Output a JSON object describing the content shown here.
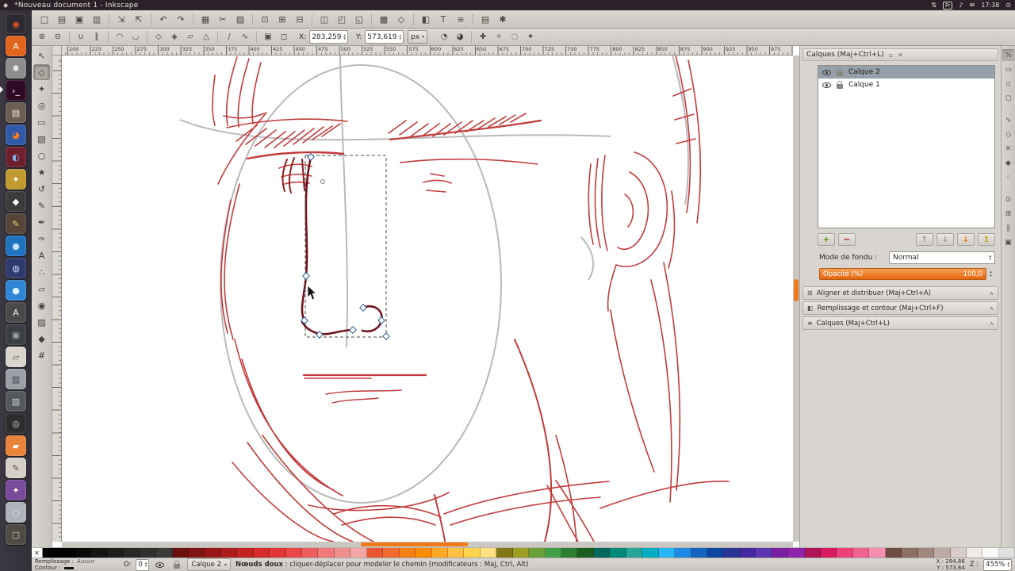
{
  "ui": {
    "spin_up": "▴",
    "spin_down": "▾",
    "caret_down": "▾",
    "collapse_glyph": "∧",
    "close_glyph": "✕",
    "float_glyph": "▫"
  },
  "desktop": {
    "title": "*Nouveau document 1 - Inkscape",
    "app_icon_glyph": "◆",
    "indicators": [
      {
        "name": "indicator-network",
        "glyph": "⇅"
      },
      {
        "name": "indicator-keyboard",
        "glyph": "Fr",
        "badge": true
      },
      {
        "name": "indicator-sound",
        "glyph": "♪"
      },
      {
        "name": "indicator-messages",
        "glyph": "✉"
      },
      {
        "name": "clock",
        "glyph": "17:38"
      },
      {
        "name": "indicator-session",
        "glyph": "⊙"
      }
    ]
  },
  "launcher": {
    "items": [
      {
        "name": "dash-home",
        "glyph": "◉",
        "bg": "#2d2a33",
        "fg": "#e95420"
      },
      {
        "name": "software-center",
        "glyph": "A",
        "bg": "#e0641c",
        "fg": "#ffffff"
      },
      {
        "name": "system-settings",
        "glyph": "✱",
        "bg": "#8d8d8d",
        "fg": "#f2f2f2"
      },
      {
        "name": "terminal",
        "glyph": "›_",
        "bg": "#300a24",
        "fg": "#ffffff",
        "active": true
      },
      {
        "name": "files",
        "glyph": "▤",
        "bg": "#6b5f54",
        "fg": "#f0e8dc"
      },
      {
        "name": "firefox",
        "glyph": "◕",
        "bg": "#2e5aa8",
        "fg": "#ff7a1a"
      },
      {
        "name": "media-player",
        "glyph": "◐",
        "bg": "#6e1f2e",
        "fg": "#7fb2e5"
      },
      {
        "name": "image-editor",
        "glyph": "✦",
        "bg": "#c09a2f",
        "fg": "#ffffff"
      },
      {
        "name": "inkscape",
        "glyph": "◆",
        "bg": "#3b3b3b",
        "fg": "#ffffff"
      },
      {
        "name": "pen-app",
        "glyph": "✎",
        "bg": "#57453a",
        "fg": "#f5d76e"
      },
      {
        "name": "color-app",
        "glyph": "●",
        "bg": "#1f74c0",
        "fg": "#bfe1ff"
      },
      {
        "name": "ink-app",
        "glyph": "◍",
        "bg": "#2e3a6e",
        "fg": "#cfd8ff"
      },
      {
        "name": "sphere-app",
        "glyph": "●",
        "bg": "#2f86d6",
        "fg": "#dff0ff"
      },
      {
        "name": "font-viewer",
        "glyph": "A",
        "bg": "#4a4a4a",
        "fg": "#eeeeee"
      },
      {
        "name": "utility-app",
        "glyph": "▣",
        "bg": "#3a3f44",
        "fg": "#9aa4ad"
      },
      {
        "name": "eraser-app",
        "glyph": "▱",
        "bg": "#d9d4cc",
        "fg": "#6b6257"
      },
      {
        "name": "gradient-app",
        "glyph": "▨",
        "bg": "#9aa0a6",
        "fg": "#434a51"
      },
      {
        "name": "system-monitor",
        "glyph": "▥",
        "bg": "#55595e",
        "fg": "#cfd3d8"
      },
      {
        "name": "camera-app",
        "glyph": "◎",
        "bg": "#2c2c2c",
        "fg": "#cfd3d8"
      },
      {
        "name": "folder-app",
        "glyph": "▰",
        "bg": "#e8833a",
        "fg": "#ffffff"
      },
      {
        "name": "notes-app",
        "glyph": "✎",
        "bg": "#d6d0c6",
        "fg": "#5a5248"
      },
      {
        "name": "screenshot-app",
        "glyph": "✦",
        "bg": "#7a4a9c",
        "fg": "#fff8dd"
      },
      {
        "name": "disc-burner",
        "glyph": "◌",
        "bg": "#aeb4ba",
        "fg": "#ffffff"
      },
      {
        "name": "archive-app",
        "glyph": "▢",
        "bg": "#4f4a44",
        "fg": "#d8d2c8"
      }
    ]
  },
  "commandbar": {
    "buttons": [
      {
        "name": "new-document",
        "glyph": "□"
      },
      {
        "name": "open-document",
        "glyph": "▤"
      },
      {
        "name": "save-document",
        "glyph": "▣"
      },
      {
        "name": "print-document",
        "glyph": "▥"
      },
      {
        "sep": true
      },
      {
        "name": "import",
        "glyph": "⇲"
      },
      {
        "name": "export",
        "glyph": "⇱"
      },
      {
        "sep": true
      },
      {
        "name": "undo",
        "glyph": "↶"
      },
      {
        "name": "redo",
        "glyph": "↷"
      },
      {
        "sep": true
      },
      {
        "name": "copy",
        "glyph": "▦"
      },
      {
        "name": "cut",
        "glyph": "✂"
      },
      {
        "name": "paste",
        "glyph": "▨"
      },
      {
        "sep": true
      },
      {
        "name": "zoom-selection",
        "glyph": "⊡"
      },
      {
        "name": "zoom-drawing",
        "glyph": "⊞"
      },
      {
        "name": "zoom-page",
        "glyph": "⊟"
      },
      {
        "sep": true
      },
      {
        "name": "duplicate",
        "glyph": "◫"
      },
      {
        "name": "clone",
        "glyph": "◰"
      },
      {
        "name": "unlink-clone",
        "glyph": "◱"
      },
      {
        "sep": true
      },
      {
        "name": "group",
        "glyph": "▩"
      },
      {
        "name": "ungroup",
        "glyph": "◇"
      },
      {
        "sep": true
      },
      {
        "name": "fill-stroke-dialog",
        "glyph": "◧"
      },
      {
        "name": "text-dialog",
        "glyph": "T"
      },
      {
        "name": "align-dialog",
        "glyph": "≡"
      },
      {
        "sep": true
      },
      {
        "name": "document-properties",
        "glyph": "▤"
      },
      {
        "name": "preferences",
        "glyph": "✱"
      }
    ]
  },
  "controls": {
    "icons_left": [
      {
        "name": "insert-node",
        "glyph": "⊕"
      },
      {
        "name": "delete-node",
        "glyph": "⊖"
      },
      {
        "sep": true
      },
      {
        "name": "join-nodes",
        "glyph": "∪"
      },
      {
        "name": "break-nodes",
        "glyph": "∥"
      },
      {
        "sep": true
      },
      {
        "name": "join-segment",
        "glyph": "◠"
      },
      {
        "name": "delete-segment",
        "glyph": "◡"
      },
      {
        "sep": true
      },
      {
        "name": "corner-node",
        "glyph": "◇"
      },
      {
        "name": "smooth-node",
        "glyph": "◈"
      },
      {
        "name": "symmetric-node",
        "glyph": "▱"
      },
      {
        "name": "auto-node",
        "glyph": "△"
      },
      {
        "sep": true
      },
      {
        "name": "line-segment",
        "glyph": "∕"
      },
      {
        "name": "curve-segment",
        "glyph": "∿"
      },
      {
        "sep": true
      },
      {
        "name": "object-to-path",
        "glyph": "▣"
      },
      {
        "name": "stroke-to-path",
        "glyph": "◻"
      }
    ],
    "x_label": "X:",
    "x_value": "283,259",
    "y_label": "Y:",
    "y_value": "573,619",
    "unit": "px",
    "icons_right": [
      {
        "name": "edit-clip",
        "glyph": "◔"
      },
      {
        "name": "edit-mask",
        "glyph": "◕"
      },
      {
        "sep": true
      },
      {
        "name": "show-transform-handles",
        "glyph": "✚"
      },
      {
        "name": "show-bezier-handles",
        "glyph": "✧"
      },
      {
        "name": "show-outline",
        "glyph": "◌"
      },
      {
        "name": "next-path-effect",
        "glyph": "✦"
      }
    ]
  },
  "toolbox": {
    "tools": [
      {
        "name": "tool-select",
        "glyph": "↖"
      },
      {
        "name": "tool-node",
        "glyph": "◇",
        "active": true
      },
      {
        "name": "tool-tweak",
        "glyph": "✦"
      },
      {
        "name": "tool-zoom",
        "glyph": "◎"
      },
      {
        "name": "tool-rect",
        "glyph": "▭"
      },
      {
        "name": "tool-3dbox",
        "glyph": "▧"
      },
      {
        "name": "tool-ellipse",
        "glyph": "○"
      },
      {
        "name": "tool-star",
        "glyph": "★"
      },
      {
        "name": "tool-spiral",
        "glyph": "↺"
      },
      {
        "name": "tool-pencil",
        "glyph": "✎"
      },
      {
        "name": "tool-bezier",
        "glyph": "✒"
      },
      {
        "name": "tool-calligraphy",
        "glyph": "✑"
      },
      {
        "name": "tool-text",
        "glyph": "A"
      },
      {
        "name": "tool-spray",
        "glyph": "∴"
      },
      {
        "name": "tool-eraser",
        "glyph": "▱"
      },
      {
        "name": "tool-bucket",
        "glyph": "◉"
      },
      {
        "name": "tool-gradient",
        "glyph": "▨"
      },
      {
        "name": "tool-dropper",
        "glyph": "◆"
      },
      {
        "name": "tool-connector",
        "glyph": "#"
      }
    ]
  },
  "snapbar": {
    "buttons": [
      {
        "name": "snap-toggle",
        "glyph": "%",
        "active": true
      },
      {
        "name": "snap-bbox",
        "glyph": "▭"
      },
      {
        "name": "snap-bbox-edges",
        "glyph": "▫"
      },
      {
        "name": "snap-bbox-corners",
        "glyph": "◻"
      },
      {
        "name": "snap-nodes",
        "glyph": "∿",
        "gap": true
      },
      {
        "name": "snap-paths",
        "glyph": "◇"
      },
      {
        "name": "snap-intersections",
        "glyph": "✕"
      },
      {
        "name": "snap-cusp",
        "glyph": "◆"
      },
      {
        "name": "snap-midpoints",
        "glyph": "◦"
      },
      {
        "name": "snap-centers",
        "glyph": "⊙",
        "gap": true
      },
      {
        "name": "snap-grid",
        "glyph": "⊞"
      },
      {
        "name": "snap-guides",
        "glyph": "∥"
      },
      {
        "name": "snap-page",
        "glyph": "▣"
      }
    ]
  },
  "ruler": {
    "values": [
      200,
      225,
      250,
      275,
      300,
      325,
      350,
      375,
      400,
      425,
      450,
      475,
      500,
      525,
      550,
      575,
      600,
      625,
      650,
      675,
      700,
      725,
      750,
      775,
      800,
      825,
      850,
      875,
      900,
      925,
      950,
      975
    ]
  },
  "layers_panel": {
    "title": "Calques (Maj+Ctrl+L)",
    "layers": [
      {
        "name": "Calque 2",
        "selected": true
      },
      {
        "name": "Calque 1",
        "selected": false
      }
    ],
    "buttons": [
      {
        "name": "new-layer",
        "glyph": "+",
        "color": "#4e9a06"
      },
      {
        "name": "delete-layer",
        "glyph": "−",
        "color": "#cc0000"
      },
      {
        "name": "raise-layer",
        "glyph": "↑",
        "color": "#9a958f",
        "right": true
      },
      {
        "name": "lower-layer",
        "glyph": "↓",
        "color": "#9a958f"
      },
      {
        "name": "lower-to-bottom",
        "glyph": "↓",
        "color": "#f57900"
      },
      {
        "name": "raise-to-top",
        "glyph": "↥",
        "color": "#c4a000"
      }
    ],
    "blend_label": "Mode de fondu :",
    "blend_value": "Normal",
    "opacity_label": "Opacité (%)",
    "opacity_value": "100,0"
  },
  "dock_panels": [
    {
      "label": "Aligner et distribuer (Maj+Ctrl+A)",
      "glyph": "⊞"
    },
    {
      "label": "Remplissage et contour (Maj+Ctrl+F)",
      "glyph": "◧"
    },
    {
      "label": "Calques (Maj+Ctrl+L)",
      "glyph": "≡"
    }
  ],
  "palette": {
    "none_glyph": "✕",
    "colors": [
      "#000000",
      "#000000",
      "#0a0a0a",
      "#141414",
      "#1e1e1e",
      "#282828",
      "#303030",
      "#3a3a3a",
      "#6b0f0f",
      "#801313",
      "#971717",
      "#ad1d1d",
      "#c22222",
      "#d62b2b",
      "#e23535",
      "#ea4848",
      "#ee5e5e",
      "#f07878",
      "#ef9090",
      "#f3a6a6",
      "#e8552f",
      "#f06a32",
      "#f57f17",
      "#fb8c00",
      "#ffa726",
      "#ffc046",
      "#ffd54f",
      "#ffe082",
      "#827717",
      "#9e9d24",
      "#689f38",
      "#43a047",
      "#2e7d32",
      "#1b5e20",
      "#00695c",
      "#00897b",
      "#26a69a",
      "#00acc1",
      "#29b6f6",
      "#1e88e5",
      "#1565c0",
      "#0d47a1",
      "#283593",
      "#4527a0",
      "#5e35b1",
      "#7b1fa2",
      "#8e24aa",
      "#ad1457",
      "#d81b60",
      "#ec407a",
      "#f06292",
      "#f48fb1",
      "#6d4c41",
      "#8d6e63",
      "#a1887f",
      "#bcaaa4",
      "#d7ccc8",
      "#efebe9",
      "#fafafa",
      "#e0e0e0"
    ]
  },
  "statusbar": {
    "fill_label": "Remplissage :",
    "fill_value": "Aucun",
    "stroke_label": "Contour :",
    "o_label": "O:",
    "o_value": "0",
    "layer_value": "Calque 2",
    "message_bold": "Nœuds doux",
    "message_rest": " : cliquer-déplacer pour modeler le chemin (modificateurs : Maj, Ctrl, Alt)",
    "x_label": "X :",
    "x_value": "284,86",
    "y_label": "Y :",
    "y_value": "573,84",
    "z_label": "Z :",
    "z_value": "455%"
  }
}
